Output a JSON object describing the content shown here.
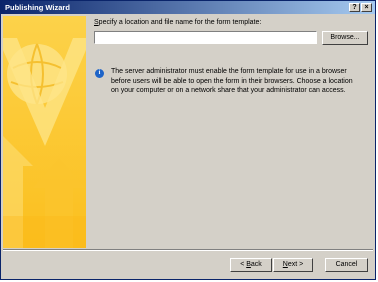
{
  "window": {
    "title": "Publishing Wizard",
    "help_glyph": "?",
    "close_glyph": "×"
  },
  "form": {
    "prompt_before": "",
    "prompt_accel": "S",
    "prompt_after": "pecify a location and file name for the form template:",
    "path_value": "",
    "browse_label": "Browse..."
  },
  "info": {
    "icon": "info-icon",
    "icon_glyph": "i",
    "message": "The server administrator must enable the form template for use in a browser before users will be able to open the form in their browsers. Choose a location on your computer or on a network share that your administrator can access."
  },
  "footer": {
    "back_prefix": "< ",
    "back_accel": "B",
    "back_suffix": "ack",
    "next_accel": "N",
    "next_suffix": "ext >",
    "cancel_label": "Cancel"
  },
  "colors": {
    "titlebar_start": "#0a246a",
    "titlebar_end": "#a6caf0",
    "dialog_face": "#d4d0c8",
    "side_yellow": "#fcd24a"
  }
}
